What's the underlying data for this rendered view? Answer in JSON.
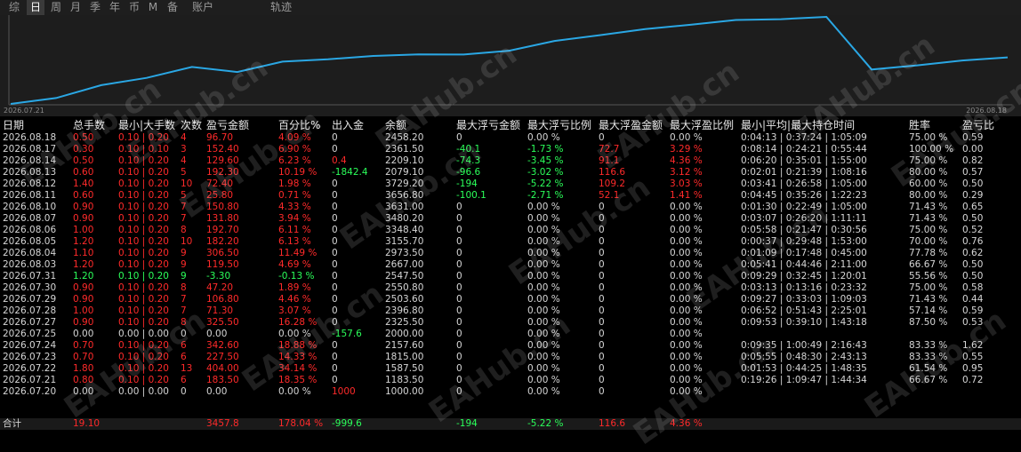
{
  "tabs": [
    "综",
    "日",
    "周",
    "月",
    "季",
    "年",
    "币",
    "M",
    "备",
    "账户",
    "轨迹"
  ],
  "active_tab": 1,
  "colors": {
    "red": "#ff2a2a",
    "green": "#2bff5a",
    "white": "#d6d6d6",
    "line": "#2aa7e4"
  },
  "watermark": "EAHub.cn",
  "chart_data": {
    "type": "line",
    "x_start_label": "2026.07.21",
    "x_end_label": "2026.08.18",
    "x": [
      "2026.07.20",
      "2026.07.21",
      "2026.07.22",
      "2026.07.23",
      "2026.07.24",
      "2026.07.25",
      "2026.07.27",
      "2026.07.28",
      "2026.07.29",
      "2026.07.30",
      "2026.07.31",
      "2026.08.03",
      "2026.08.04",
      "2026.08.05",
      "2026.08.06",
      "2026.08.07",
      "2026.08.10",
      "2026.08.11",
      "2026.08.12",
      "2026.08.13",
      "2026.08.14",
      "2026.08.17",
      "2026.08.18"
    ],
    "values": [
      1000.0,
      1183.5,
      1587.5,
      1815.0,
      2157.6,
      2000.0,
      2325.5,
      2396.8,
      2503.6,
      2550.8,
      2547.5,
      2667.0,
      2973.5,
      3155.7,
      3348.4,
      3480.2,
      3631.0,
      3656.8,
      3729.2,
      2079.1,
      2209.1,
      2361.5,
      2458.2
    ]
  },
  "columns": [
    "日期",
    "总手数",
    "最小|大手数",
    "次数",
    "盈亏金额",
    "百分比%",
    "出入金",
    "余额",
    "最大浮亏金额",
    "最大浮亏比例",
    "最大浮盈金额",
    "最大浮盈比例",
    "最小|平均|最大持仓时间",
    "胜率",
    "盈亏比"
  ],
  "rows": [
    {
      "date": "2026.08.18",
      "lots": "0.50",
      "minmax": "0.10 | 0.20",
      "count": "4",
      "pnl": "96.70",
      "pct": "4.09 %",
      "io": "0",
      "bal": "2458.20",
      "mdd": "0",
      "mddp": "0.00 %",
      "mfe": "0",
      "mfep": "0.00 %",
      "time": "0:04:13 | 0:37:24 | 1:05:09",
      "win": "75.00 %",
      "pr": "0.59",
      "c": "red",
      "io_c": "white",
      "mdd_c": "white",
      "mfe_c": "white"
    },
    {
      "date": "2026.08.17",
      "lots": "0.30",
      "minmax": "0.10 | 0.10",
      "count": "3",
      "pnl": "152.40",
      "pct": "6.90 %",
      "io": "0",
      "bal": "2361.50",
      "mdd": "-40.1",
      "mddp": "-1.73 %",
      "mfe": "72.7",
      "mfep": "3.29 %",
      "time": "0:08:14 | 0:24:21 | 0:55:44",
      "win": "100.00 %",
      "pr": "0.00",
      "c": "red",
      "io_c": "white",
      "mdd_c": "green",
      "mfe_c": "red"
    },
    {
      "date": "2026.08.14",
      "lots": "0.50",
      "minmax": "0.10 | 0.20",
      "count": "4",
      "pnl": "129.60",
      "pct": "6.23 %",
      "io": "0.4",
      "bal": "2209.10",
      "mdd": "-74.3",
      "mddp": "-3.45 %",
      "mfe": "91.1",
      "mfep": "4.36 %",
      "time": "0:06:20 | 0:35:01 | 1:55:00",
      "win": "75.00 %",
      "pr": "0.82",
      "c": "red",
      "io_c": "red",
      "mdd_c": "green",
      "mfe_c": "red"
    },
    {
      "date": "2026.08.13",
      "lots": "0.60",
      "minmax": "0.10 | 0.20",
      "count": "5",
      "pnl": "192.30",
      "pct": "10.19 %",
      "io": "-1842.4",
      "bal": "2079.10",
      "mdd": "-96.6",
      "mddp": "-3.02 %",
      "mfe": "116.6",
      "mfep": "3.12 %",
      "time": "0:02:01 | 0:21:39 | 1:08:16",
      "win": "80.00 %",
      "pr": "0.57",
      "c": "red",
      "io_c": "green",
      "mdd_c": "green",
      "mfe_c": "red"
    },
    {
      "date": "2026.08.12",
      "lots": "1.40",
      "minmax": "0.10 | 0.20",
      "count": "10",
      "pnl": "72.40",
      "pct": "1.98 %",
      "io": "0",
      "bal": "3729.20",
      "mdd": "-194",
      "mddp": "-5.22 %",
      "mfe": "109.2",
      "mfep": "3.03 %",
      "time": "0:03:41 | 0:26:58 | 1:05:00",
      "win": "60.00 %",
      "pr": "0.50",
      "c": "red",
      "io_c": "white",
      "mdd_c": "green",
      "mfe_c": "red"
    },
    {
      "date": "2026.08.11",
      "lots": "0.60",
      "minmax": "0.10 | 0.20",
      "count": "5",
      "pnl": "25.80",
      "pct": "0.71 %",
      "io": "0",
      "bal": "3656.80",
      "mdd": "-100.1",
      "mddp": "-2.71 %",
      "mfe": "52.1",
      "mfep": "1.41 %",
      "time": "0:04:45 | 0:35:26 | 1:22:23",
      "win": "80.00 %",
      "pr": "0.29",
      "c": "red",
      "io_c": "white",
      "mdd_c": "green",
      "mfe_c": "red"
    },
    {
      "date": "2026.08.10",
      "lots": "0.90",
      "minmax": "0.10 | 0.20",
      "count": "7",
      "pnl": "150.80",
      "pct": "4.33 %",
      "io": "0",
      "bal": "3631.00",
      "mdd": "0",
      "mddp": "0.00 %",
      "mfe": "0",
      "mfep": "0.00 %",
      "time": "0:01:30 | 0:22:49 | 1:05:00",
      "win": "71.43 %",
      "pr": "0.65",
      "c": "red",
      "io_c": "white",
      "mdd_c": "white",
      "mfe_c": "white"
    },
    {
      "date": "2026.08.07",
      "lots": "0.90",
      "minmax": "0.10 | 0.20",
      "count": "7",
      "pnl": "131.80",
      "pct": "3.94 %",
      "io": "0",
      "bal": "3480.20",
      "mdd": "0",
      "mddp": "0.00 %",
      "mfe": "0",
      "mfep": "0.00 %",
      "time": "0:03:07 | 0:26:20 | 1:11:11",
      "win": "71.43 %",
      "pr": "0.50",
      "c": "red",
      "io_c": "white",
      "mdd_c": "white",
      "mfe_c": "white"
    },
    {
      "date": "2026.08.06",
      "lots": "1.00",
      "minmax": "0.10 | 0.20",
      "count": "8",
      "pnl": "192.70",
      "pct": "6.11 %",
      "io": "0",
      "bal": "3348.40",
      "mdd": "0",
      "mddp": "0.00 %",
      "mfe": "0",
      "mfep": "0.00 %",
      "time": "0:05:58 | 0:21:47 | 0:30:56",
      "win": "75.00 %",
      "pr": "0.52",
      "c": "red",
      "io_c": "white",
      "mdd_c": "white",
      "mfe_c": "white"
    },
    {
      "date": "2026.08.05",
      "lots": "1.20",
      "minmax": "0.10 | 0.20",
      "count": "10",
      "pnl": "182.20",
      "pct": "6.13 %",
      "io": "0",
      "bal": "3155.70",
      "mdd": "0",
      "mddp": "0.00 %",
      "mfe": "0",
      "mfep": "0.00 %",
      "time": "0:00:37 | 0:29:48 | 1:53:00",
      "win": "70.00 %",
      "pr": "0.76",
      "c": "red",
      "io_c": "white",
      "mdd_c": "white",
      "mfe_c": "white"
    },
    {
      "date": "2026.08.04",
      "lots": "1.10",
      "minmax": "0.10 | 0.20",
      "count": "9",
      "pnl": "306.50",
      "pct": "11.49 %",
      "io": "0",
      "bal": "2973.50",
      "mdd": "0",
      "mddp": "0.00 %",
      "mfe": "0",
      "mfep": "0.00 %",
      "time": "0:01:09 | 0:17:48 | 0:45:00",
      "win": "77.78 %",
      "pr": "0.62",
      "c": "red",
      "io_c": "white",
      "mdd_c": "white",
      "mfe_c": "white"
    },
    {
      "date": "2026.08.03",
      "lots": "1.20",
      "minmax": "0.10 | 0.20",
      "count": "9",
      "pnl": "119.50",
      "pct": "4.69 %",
      "io": "0",
      "bal": "2667.00",
      "mdd": "0",
      "mddp": "0.00 %",
      "mfe": "0",
      "mfep": "0.00 %",
      "time": "0:05:41 | 0:44:46 | 2:11:00",
      "win": "66.67 %",
      "pr": "0.50",
      "c": "red",
      "io_c": "white",
      "mdd_c": "white",
      "mfe_c": "white"
    },
    {
      "date": "2026.07.31",
      "lots": "1.20",
      "minmax": "0.10 | 0.20",
      "count": "9",
      "pnl": "-3.30",
      "pct": "-0.13 %",
      "io": "0",
      "bal": "2547.50",
      "mdd": "0",
      "mddp": "0.00 %",
      "mfe": "0",
      "mfep": "0.00 %",
      "time": "0:09:29 | 0:32:45 | 1:20:01",
      "win": "55.56 %",
      "pr": "0.50",
      "c": "green",
      "io_c": "white",
      "mdd_c": "white",
      "mfe_c": "white"
    },
    {
      "date": "2026.07.30",
      "lots": "0.90",
      "minmax": "0.10 | 0.20",
      "count": "8",
      "pnl": "47.20",
      "pct": "1.89 %",
      "io": "0",
      "bal": "2550.80",
      "mdd": "0",
      "mddp": "0.00 %",
      "mfe": "0",
      "mfep": "0.00 %",
      "time": "0:03:13 | 0:13:16 | 0:23:32",
      "win": "75.00 %",
      "pr": "0.58",
      "c": "red",
      "io_c": "white",
      "mdd_c": "white",
      "mfe_c": "white"
    },
    {
      "date": "2026.07.29",
      "lots": "0.90",
      "minmax": "0.10 | 0.20",
      "count": "7",
      "pnl": "106.80",
      "pct": "4.46 %",
      "io": "0",
      "bal": "2503.60",
      "mdd": "0",
      "mddp": "0.00 %",
      "mfe": "0",
      "mfep": "0.00 %",
      "time": "0:09:27 | 0:33:03 | 1:09:03",
      "win": "71.43 %",
      "pr": "0.44",
      "c": "red",
      "io_c": "white",
      "mdd_c": "white",
      "mfe_c": "white"
    },
    {
      "date": "2026.07.28",
      "lots": "1.00",
      "minmax": "0.10 | 0.20",
      "count": "7",
      "pnl": "71.30",
      "pct": "3.07 %",
      "io": "0",
      "bal": "2396.80",
      "mdd": "0",
      "mddp": "0.00 %",
      "mfe": "0",
      "mfep": "0.00 %",
      "time": "0:06:52 | 0:51:43 | 2:25:01",
      "win": "57.14 %",
      "pr": "0.59",
      "c": "red",
      "io_c": "white",
      "mdd_c": "white",
      "mfe_c": "white"
    },
    {
      "date": "2026.07.27",
      "lots": "0.90",
      "minmax": "0.10 | 0.20",
      "count": "8",
      "pnl": "325.50",
      "pct": "16.28 %",
      "io": "0",
      "bal": "2325.50",
      "mdd": "0",
      "mddp": "0.00 %",
      "mfe": "0",
      "mfep": "0.00 %",
      "time": "0:09:53 | 0:39:10 | 1:43:18",
      "win": "87.50 %",
      "pr": "0.53",
      "c": "red",
      "io_c": "white",
      "mdd_c": "white",
      "mfe_c": "white"
    },
    {
      "date": "2026.07.25",
      "lots": "0.00",
      "minmax": "0.00 | 0.00",
      "count": "0",
      "pnl": "0.00",
      "pct": "0.00 %",
      "io": "-157.6",
      "bal": "2000.00",
      "mdd": "0",
      "mddp": "0.00 %",
      "mfe": "0",
      "mfep": "0.00 %",
      "time": "",
      "win": "",
      "pr": "",
      "c": "white",
      "io_c": "green",
      "mdd_c": "white",
      "mfe_c": "white"
    },
    {
      "date": "2026.07.24",
      "lots": "0.70",
      "minmax": "0.10 | 0.20",
      "count": "6",
      "pnl": "342.60",
      "pct": "18.88 %",
      "io": "0",
      "bal": "2157.60",
      "mdd": "0",
      "mddp": "0.00 %",
      "mfe": "0",
      "mfep": "0.00 %",
      "time": "0:09:35 | 1:00:49 | 2:16:43",
      "win": "83.33 %",
      "pr": "1.62",
      "c": "red",
      "io_c": "white",
      "mdd_c": "white",
      "mfe_c": "white"
    },
    {
      "date": "2026.07.23",
      "lots": "0.70",
      "minmax": "0.10 | 0.20",
      "count": "6",
      "pnl": "227.50",
      "pct": "14.33 %",
      "io": "0",
      "bal": "1815.00",
      "mdd": "0",
      "mddp": "0.00 %",
      "mfe": "0",
      "mfep": "0.00 %",
      "time": "0:05:55 | 0:48:30 | 2:43:13",
      "win": "83.33 %",
      "pr": "0.55",
      "c": "red",
      "io_c": "white",
      "mdd_c": "white",
      "mfe_c": "white"
    },
    {
      "date": "2026.07.22",
      "lots": "1.80",
      "minmax": "0.10 | 0.20",
      "count": "13",
      "pnl": "404.00",
      "pct": "34.14 %",
      "io": "0",
      "bal": "1587.50",
      "mdd": "0",
      "mddp": "0.00 %",
      "mfe": "0",
      "mfep": "0.00 %",
      "time": "0:01:53 | 0:44:25 | 1:48:35",
      "win": "61.54 %",
      "pr": "0.95",
      "c": "red",
      "io_c": "white",
      "mdd_c": "white",
      "mfe_c": "white"
    },
    {
      "date": "2026.07.21",
      "lots": "0.80",
      "minmax": "0.10 | 0.20",
      "count": "6",
      "pnl": "183.50",
      "pct": "18.35 %",
      "io": "0",
      "bal": "1183.50",
      "mdd": "0",
      "mddp": "0.00 %",
      "mfe": "0",
      "mfep": "0.00 %",
      "time": "0:19:26 | 1:09:47 | 1:44:34",
      "win": "66.67 %",
      "pr": "0.72",
      "c": "red",
      "io_c": "white",
      "mdd_c": "white",
      "mfe_c": "white"
    },
    {
      "date": "2026.07.20",
      "lots": "0.00",
      "minmax": "0.00 | 0.00",
      "count": "0",
      "pnl": "0.00",
      "pct": "0.00 %",
      "io": "1000",
      "bal": "1000.00",
      "mdd": "0",
      "mddp": "0.00 %",
      "mfe": "0",
      "mfep": "0.00 %",
      "time": "",
      "win": "",
      "pr": "",
      "c": "white",
      "io_c": "red",
      "mdd_c": "white",
      "mfe_c": "white"
    }
  ],
  "total": {
    "date": "合计",
    "lots": "19.10",
    "minmax": "",
    "count": "",
    "pnl": "3457.8",
    "pct": "178.04 %",
    "io": "-999.6",
    "bal": "",
    "mdd": "-194",
    "mddp": "-5.22 %",
    "mfe": "116.6",
    "mfep": "4.36 %",
    "time": "",
    "win": "",
    "pr": "",
    "c": "red",
    "io_c": "green",
    "mdd_c": "green",
    "mfe_c": "red"
  }
}
